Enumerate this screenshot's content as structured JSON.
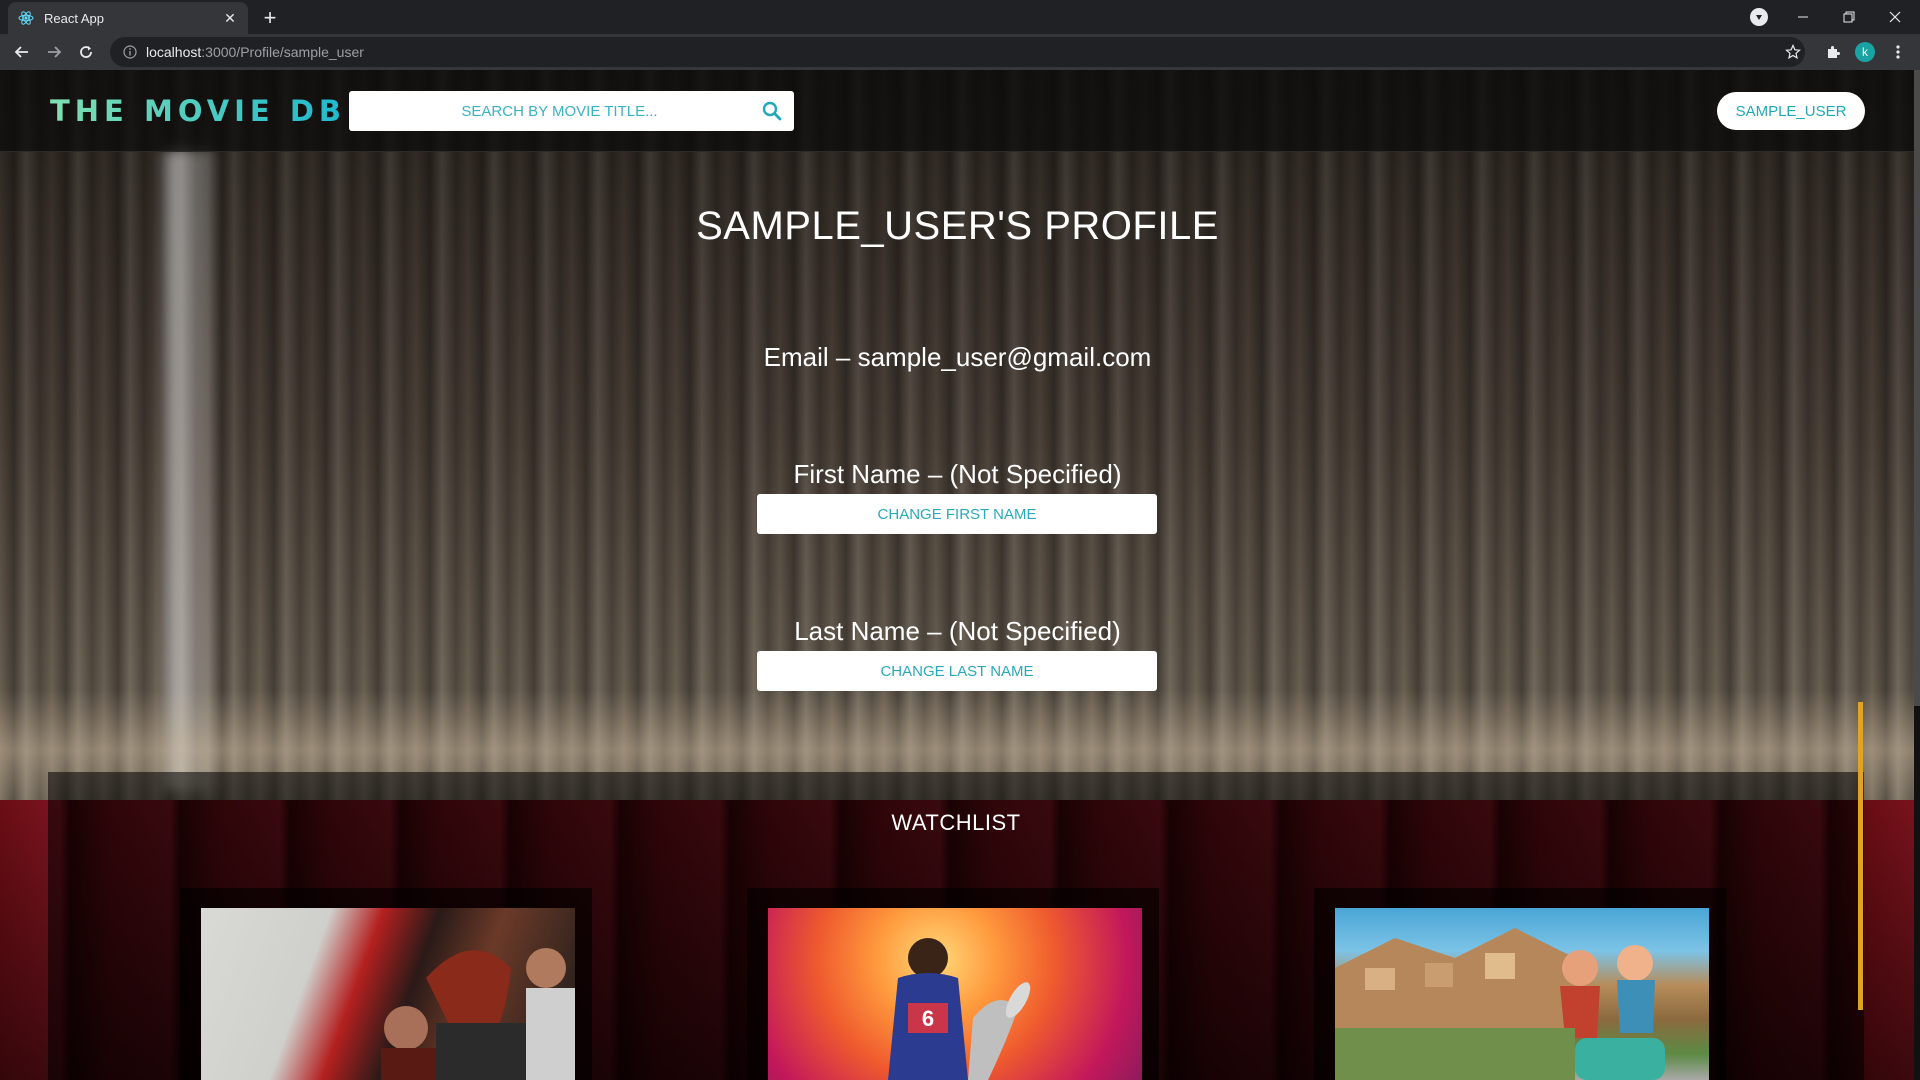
{
  "browser": {
    "tab_title": "React App",
    "new_tab_symbol": "+",
    "url_host": "localhost",
    "url_rest": ":3000/Profile/sample_user",
    "profile_initial": "k"
  },
  "navbar": {
    "logo_text": "THE MOVIE DB",
    "search_placeholder": "SEARCH BY MOVIE TITLE...",
    "user_button": "SAMPLE_USER"
  },
  "profile": {
    "title": "SAMPLE_USER'S PROFILE",
    "email_line": "Email – sample_user@gmail.com",
    "first_name_line": "First Name – (Not Specified)",
    "change_first_label": "CHANGE FIRST NAME",
    "last_name_line": "Last Name – (Not Specified)",
    "change_last_label": "CHANGE LAST NAME"
  },
  "watchlist": {
    "title": "WATCHLIST",
    "items": [
      {
        "poster_name": "movie-poster-1"
      },
      {
        "poster_name": "movie-poster-2"
      },
      {
        "poster_name": "movie-poster-3"
      }
    ]
  },
  "colors": {
    "accent": "#1fa8b8",
    "logo_gradient_start": "#7ee0b1",
    "logo_gradient_end": "#1fb8cf",
    "highlight_bar": "#e3a322"
  }
}
